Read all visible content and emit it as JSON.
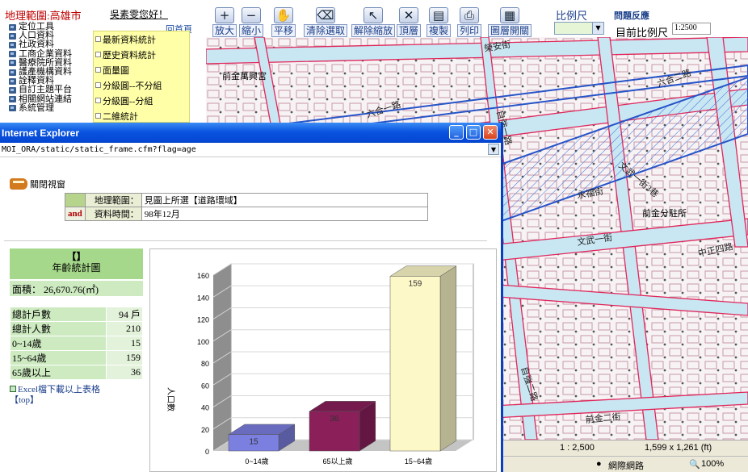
{
  "app": {
    "region_label": "地理範圍:高雄市",
    "greeting": "吳素雯您好！",
    "home_link": "回首頁"
  },
  "menu": {
    "items": [
      "定位工具",
      "人口資料",
      "社政資料",
      "工商企業資料",
      "醫療院所資料",
      "護產機構資料",
      "詮釋資料",
      "自訂主題平台",
      "相關網站連結",
      "系統管理"
    ],
    "submenu": [
      "最新資料統計",
      "歷史資料統計",
      "面量圖",
      "分級圓--不分組",
      "分級圓--分組",
      "二維統計"
    ]
  },
  "toolbar": {
    "buttons": [
      {
        "label": "放大",
        "icon": "zoom-in-icon",
        "glyph": "+"
      },
      {
        "label": "縮小",
        "icon": "zoom-out-icon",
        "glyph": "−"
      },
      {
        "label": "平移",
        "icon": "pan-hand-icon",
        "glyph": "✋"
      },
      {
        "label": "清除選取",
        "icon": "eraser-icon",
        "glyph": "⌫"
      },
      {
        "label": "解除縮放",
        "icon": "cursor-icon",
        "glyph": "↖"
      },
      {
        "label": "頂層",
        "icon": "top-layer-icon",
        "glyph": "✕"
      },
      {
        "label": "複製",
        "icon": "copy-icon",
        "glyph": "▤"
      },
      {
        "label": "列印",
        "icon": "print-icon",
        "glyph": "⎙"
      },
      {
        "label": "圖層開關",
        "icon": "layer-toggle-icon",
        "glyph": "▦"
      }
    ],
    "scale_title": "比例尺",
    "feedback": "問題反應",
    "current_scale_label": "目前比例尺",
    "current_scale_value": "1:2500"
  },
  "map": {
    "labels": [
      "前金萬興宮",
      "前金分駐所",
      "六合一路",
      "六合二路",
      "中正四路",
      "永福街",
      "文武一街",
      "榮安街",
      "自強一路",
      "自強二路",
      "前金二街",
      "文武一街3巷"
    ],
    "status_scale": "1 : 2,500",
    "status_coords": "1,599 x 1,261 (ft)"
  },
  "ie_status": {
    "zone": "網際網路",
    "zoom": "100%"
  },
  "popup": {
    "title": "Internet Explorer",
    "url": "MOI_ORA/static/static_frame.cfm?flag=age",
    "close_view": "關閉視窗",
    "query": {
      "and_label": "and",
      "range_key": "地理範圍：",
      "range_val": "見圖上所選【道路環域】",
      "time_key": "資料時間：",
      "time_val": "98年12月"
    },
    "stats": {
      "title_bracket": "【】",
      "title": "年齡統計圖",
      "area": "面積： 26,670.76(㎡)",
      "rows": [
        {
          "k": "總計戶數",
          "v": "94 戶"
        },
        {
          "k": "總計人數",
          "v": "210"
        },
        {
          "k": "0~14歲",
          "v": "15"
        },
        {
          "k": "15~64歲",
          "v": "159"
        },
        {
          "k": "65歲以上",
          "v": "36"
        }
      ],
      "download": "Excel檔下載以上表格",
      "top": "【top】"
    }
  },
  "chart_data": {
    "type": "bar",
    "categories": [
      "0~14歲",
      "65以上歲",
      "15~64歲"
    ],
    "values": [
      15,
      36,
      159
    ],
    "ylabel": "人口數",
    "ylim": [
      0,
      160
    ],
    "yticks": [
      0,
      20,
      40,
      60,
      80,
      100,
      120,
      140,
      160
    ],
    "colors": [
      "#7b7fe0",
      "#8a1f5a",
      "#fdf8c8"
    ],
    "grid": true
  }
}
